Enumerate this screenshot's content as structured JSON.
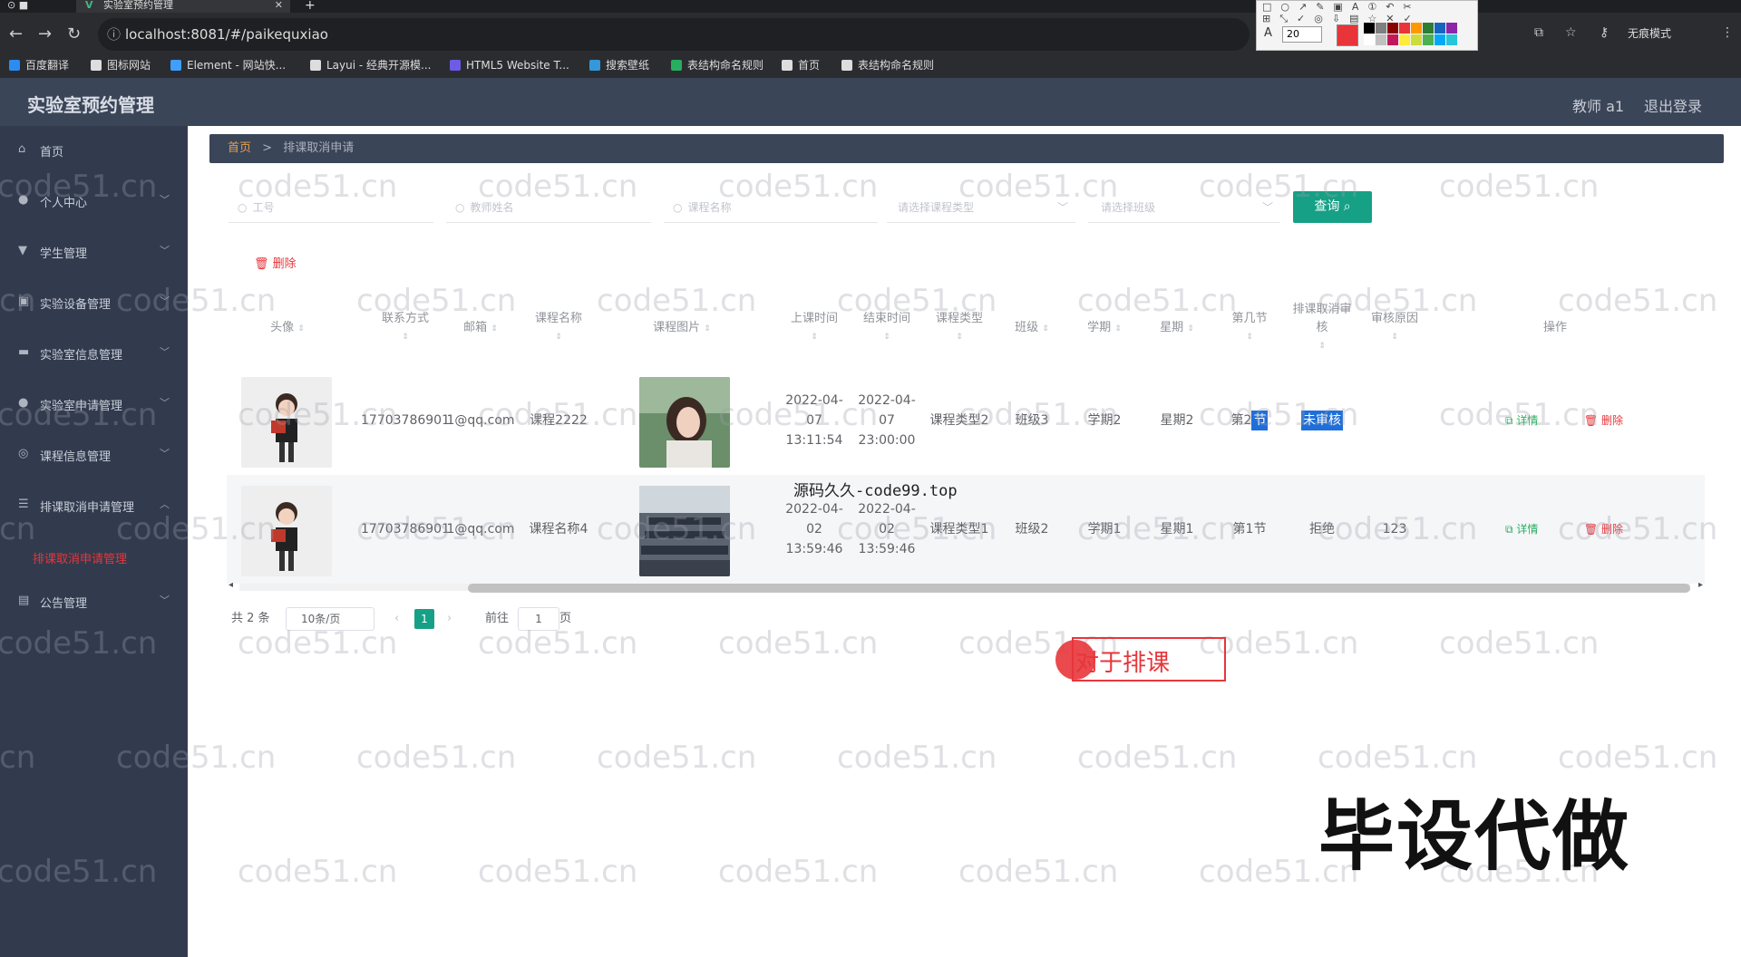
{
  "browser": {
    "tab_title": "实验室预约管理",
    "url": "localhost:8081/#/paikequxiao",
    "incognito_label": "无痕模式",
    "bookmarks": [
      {
        "label": "百度翻译",
        "color": "#2d8cf0"
      },
      {
        "label": "图标网站",
        "color": "#dddddd"
      },
      {
        "label": "Element - 网站快...",
        "color": "#409eff"
      },
      {
        "label": "Layui - 经典开源模...",
        "color": "#dddddd"
      },
      {
        "label": "HTML5 Website T...",
        "color": "#6c5ce7"
      },
      {
        "label": "搜索壁纸",
        "color": "#3498db"
      },
      {
        "label": "表结构命名规则",
        "color": "#27ae60"
      },
      {
        "label": "首页",
        "color": "#dddddd"
      },
      {
        "label": "表结构命名规则",
        "color": "#dddddd"
      }
    ],
    "annot_size": "20"
  },
  "header": {
    "title": "实验室预约管理",
    "user": "教师 a1",
    "logout": "退出登录"
  },
  "sidebar": {
    "items": [
      {
        "label": "首页",
        "icon": "home-icon"
      },
      {
        "label": "个人中心",
        "icon": "user-icon"
      },
      {
        "label": "学生管理",
        "icon": "student-icon"
      },
      {
        "label": "实验设备管理",
        "icon": "equipment-icon"
      },
      {
        "label": "实验室信息管理",
        "icon": "lab-icon"
      },
      {
        "label": "实验室申请管理",
        "icon": "user-icon"
      },
      {
        "label": "课程信息管理",
        "icon": "course-icon"
      },
      {
        "label": "排课取消申请管理",
        "icon": "list-icon"
      },
      {
        "label": "公告管理",
        "icon": "notice-icon"
      }
    ],
    "active_sub": "排课取消申请管理"
  },
  "breadcrumb": {
    "home": "首页",
    "sep": ">",
    "current": "排课取消申请"
  },
  "filters": {
    "gonghao": "工号",
    "teacher_name": "教师姓名",
    "course_name": "课程名称",
    "course_type": "请选择课程类型",
    "class": "请选择班级",
    "search_btn": "查询"
  },
  "actions": {
    "delete": "删除"
  },
  "table": {
    "headers": [
      "头像",
      "联系方式",
      "邮箱",
      "课程名称",
      "课程图片",
      "上课时间",
      "结束时间",
      "课程类型",
      "班级",
      "学期",
      "星期",
      "第几节",
      "排课取消审核",
      "审核原因",
      "操作"
    ],
    "rows": [
      {
        "contact": "17703786901",
        "email": "1@qq.com",
        "course_name": "课程2222",
        "start": "2022-04-07 13:11:54",
        "end": "2022-04-07 23:00:00",
        "type": "课程类型2",
        "class": "班级3",
        "term": "学期2",
        "week": "星期2",
        "section_a": "第2",
        "section_b": "节",
        "audit": "未审核",
        "reason": "",
        "detail": "详情",
        "del": "删除"
      },
      {
        "contact": "17703786901",
        "email": "1@qq.com",
        "course_name": "课程名称4",
        "start": "2022-04-02 13:59:46",
        "end": "2022-04-02 13:59:46",
        "type": "课程类型1",
        "class": "班级2",
        "term": "学期1",
        "week": "星期1",
        "section": "第1节",
        "audit": "拒绝",
        "reason": "123",
        "detail": "详情",
        "del": "删除"
      }
    ]
  },
  "pager": {
    "total": "共 2 条",
    "size": "10条/页",
    "current": "1",
    "goto": "前往",
    "page_input": "1",
    "unit": "页"
  },
  "overlays": {
    "source_mark": "源码久久-code99.top",
    "annot_text": "对于排课",
    "big_mark": "毕设代做",
    "watermark": "code51.cn"
  }
}
